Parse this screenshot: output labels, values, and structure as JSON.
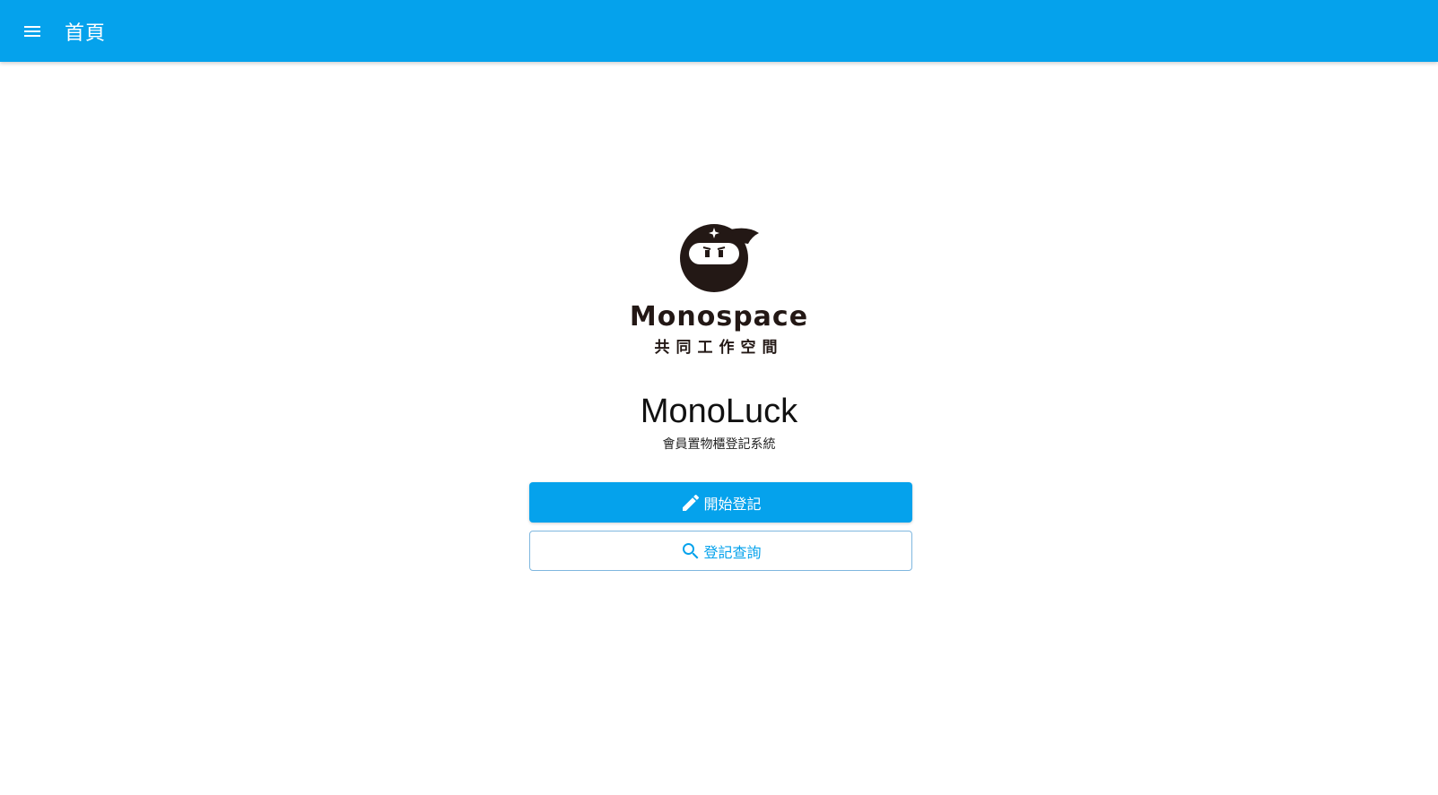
{
  "colors": {
    "primary": "#05a2ec",
    "logo_dark": "#231815",
    "outline_border": "#7fb7df"
  },
  "header": {
    "menu_icon": "menu-icon",
    "title": "首頁"
  },
  "logo": {
    "wordmark": "Monospace",
    "subtitle": "共同工作空間",
    "mascot_icon": "ninja-mascot-icon"
  },
  "main": {
    "title": "MonoLuck",
    "subtitle": "會員置物櫃登記系統"
  },
  "actions": {
    "start": {
      "label": "開始登記",
      "icon": "pencil-icon"
    },
    "query": {
      "label": "登記查詢",
      "icon": "search-icon"
    }
  }
}
